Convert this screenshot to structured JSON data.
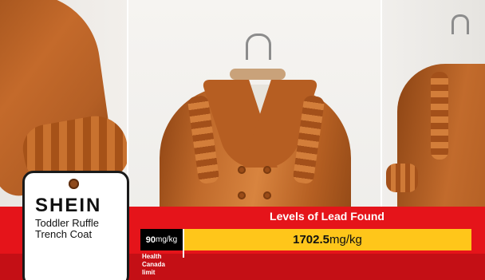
{
  "tag": {
    "brand": "SHEIN",
    "product_line1": "Toddler Ruffle",
    "product_line2": "Trench Coat"
  },
  "banner": {
    "title": "Levels of Lead Found",
    "limit_value": "90",
    "limit_unit": "mg/kg",
    "found_value": "1702.5",
    "found_unit": "mg/kg",
    "limit_label_line1": "Health",
    "limit_label_line2": "Canada",
    "limit_label_line3": "limit"
  },
  "colors": {
    "banner_red": "#e5141a",
    "found_bar_yellow": "#ffc61a",
    "limit_bar_black": "#000000",
    "coat_brown": "#c06a2b"
  }
}
